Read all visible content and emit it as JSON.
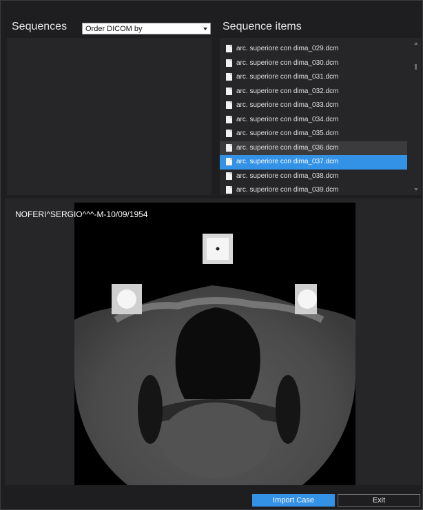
{
  "sequences": {
    "title": "Sequences",
    "order_dropdown": {
      "value": "Order DICOM by"
    },
    "items": []
  },
  "sequence_items": {
    "title": "Sequence items",
    "files": [
      "arc. superiore con dima_029.dcm",
      "arc. superiore con dima_030.dcm",
      "arc. superiore con dima_031.dcm",
      "arc. superiore con dima_032.dcm",
      "arc. superiore con dima_033.dcm",
      "arc. superiore con dima_034.dcm",
      "arc. superiore con dima_035.dcm",
      "arc. superiore con dima_036.dcm",
      "arc. superiore con dima_037.dcm",
      "arc. superiore con dima_038.dcm",
      "arc. superiore con dima_039.dcm"
    ],
    "hovered_file": "arc. superiore con dima_036.dcm",
    "selected_file": "arc. superiore con dima_037.dcm"
  },
  "viewer": {
    "patient_label": "NOFERI^SERGIO^^^-M-10/09/1954"
  },
  "buttons": {
    "import": "Import Case",
    "exit": "Exit"
  },
  "colors": {
    "accent": "#3391e6",
    "background": "#1e1e20",
    "panel": "#262628"
  }
}
